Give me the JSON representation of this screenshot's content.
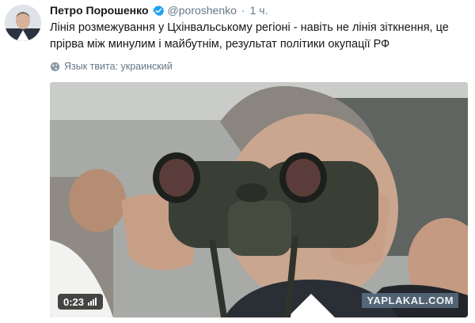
{
  "tweet": {
    "author_name": "Петро Порошенко",
    "handle": "@poroshenko",
    "separator": "·",
    "time": "1 ч.",
    "text": "Лінія розмежування у Цхінвальському регіоні - навіть не лінія зіткнення, це прірва між минулим і майбутнім, результат політики окупації РФ",
    "language_note": "Язык твита: украинский"
  },
  "media": {
    "duration": "0:23",
    "watermark": "YAPLAKAL.COM"
  },
  "icons": {
    "verified": "verified-badge-icon",
    "globe": "globe-icon",
    "volume": "volume-icon"
  },
  "colors": {
    "verified": "#1da1f2",
    "secondary_text": "#657786",
    "primary_text": "#14171a"
  }
}
